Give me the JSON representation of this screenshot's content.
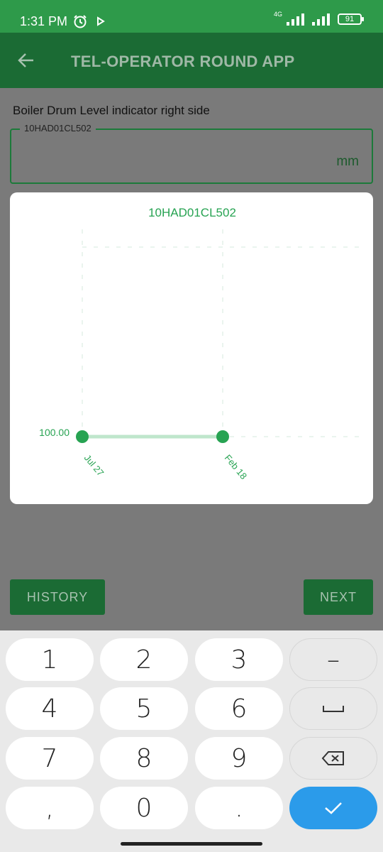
{
  "status_bar": {
    "time": "1:31 PM",
    "network": "4G",
    "battery": "91"
  },
  "app_bar": {
    "title": "TEL-OPERATOR ROUND APP",
    "back_icon": "arrow-back-icon"
  },
  "form": {
    "label": "Boiler Drum Level indicator right side",
    "field_legend": "10HAD01CL502",
    "field_value": "",
    "unit": "mm"
  },
  "chart_data": {
    "type": "line",
    "title": "10HAD01CL502",
    "x": [
      "Jul 27",
      "Feb 18"
    ],
    "series": [
      {
        "values": [
          100.0,
          100.0
        ]
      }
    ],
    "y_tick_labels": [
      "100.00"
    ],
    "grid": true,
    "colors": {
      "line": "#bfe6cc",
      "point": "#27a352",
      "text": "#27a352"
    }
  },
  "buttons": {
    "history": "HISTORY",
    "next": "NEXT"
  },
  "keyboard": {
    "keys": [
      "1",
      "2",
      "3",
      "4",
      "5",
      "6",
      "7",
      "8",
      "9",
      ",",
      "0",
      "."
    ],
    "minus": "–",
    "icons": [
      "space-icon",
      "backspace-icon",
      "check-icon"
    ]
  },
  "colors": {
    "status_bar": "#2e9a4a",
    "app_bar": "#1b6b34",
    "scrim": "#7a7a7a",
    "accent": "#27a352",
    "done_key": "#2b9bea"
  }
}
